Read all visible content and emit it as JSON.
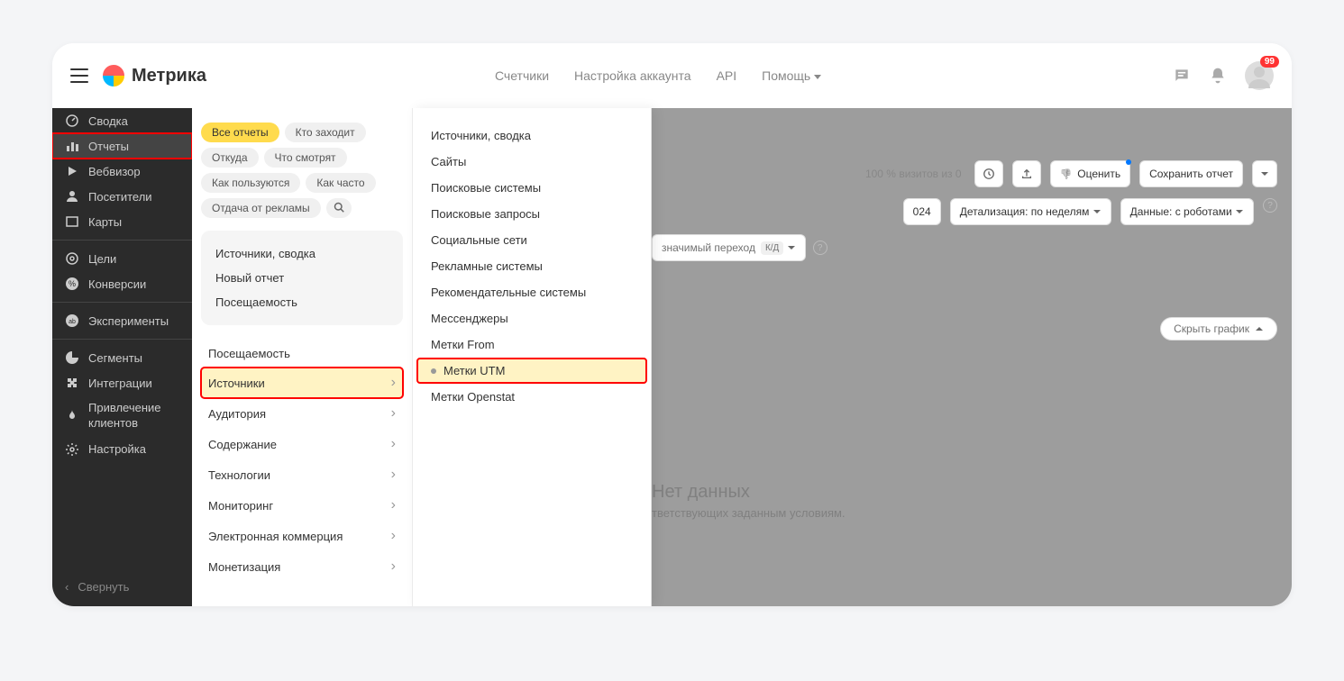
{
  "header": {
    "logo_text": "Метрика",
    "nav": [
      "Счетчики",
      "Настройка аккаунта",
      "API",
      "Помощь"
    ],
    "badge": "99"
  },
  "sidebar": {
    "items": [
      {
        "label": "Сводка",
        "icon": "gauge"
      },
      {
        "label": "Отчеты",
        "icon": "bar-chart",
        "active": true
      },
      {
        "label": "Вебвизор",
        "icon": "play"
      },
      {
        "label": "Посетители",
        "icon": "user"
      },
      {
        "label": "Карты",
        "icon": "map"
      }
    ],
    "items2": [
      {
        "label": "Цели",
        "icon": "target"
      },
      {
        "label": "Конверсии",
        "icon": "percent"
      }
    ],
    "items3": [
      {
        "label": "Эксперименты",
        "icon": "ab"
      }
    ],
    "items4": [
      {
        "label": "Сегменты",
        "icon": "pie"
      },
      {
        "label": "Интеграции",
        "icon": "puzzle"
      },
      {
        "label": "Привлечение клиентов",
        "icon": "flame"
      },
      {
        "label": "Настройка",
        "icon": "gear"
      }
    ],
    "collapse": "Свернуть"
  },
  "panel1": {
    "chips": [
      "Все отчеты",
      "Кто заходит",
      "Откуда",
      "Что смотрят",
      "Как пользуются",
      "Как часто",
      "Отдача от рекламы"
    ],
    "quick": [
      "Источники, сводка",
      "Новый отчет",
      "Посещаемость"
    ],
    "categories": [
      {
        "label": "Посещаемость",
        "chevron": false
      },
      {
        "label": "Источники",
        "chevron": true,
        "highlighted": true
      },
      {
        "label": "Аудитория",
        "chevron": true
      },
      {
        "label": "Содержание",
        "chevron": true
      },
      {
        "label": "Технологии",
        "chevron": true
      },
      {
        "label": "Мониторинг",
        "chevron": true
      },
      {
        "label": "Электронная коммерция",
        "chevron": true
      },
      {
        "label": "Монетизация",
        "chevron": true
      }
    ]
  },
  "panel2": {
    "items": [
      {
        "label": "Источники, сводка"
      },
      {
        "label": "Сайты"
      },
      {
        "label": "Поисковые системы"
      },
      {
        "label": "Поисковые запросы"
      },
      {
        "label": "Социальные сети"
      },
      {
        "label": "Рекламные системы"
      },
      {
        "label": "Рекомендательные системы"
      },
      {
        "label": "Мессенджеры"
      },
      {
        "label": "Метки From"
      },
      {
        "label": "Метки UTM",
        "highlighted": true,
        "dot": true
      },
      {
        "label": "Метки Openstat"
      }
    ]
  },
  "main": {
    "visits_text": "100 % визитов из 0",
    "evaluate": "Оценить",
    "save_report": "Сохранить отчет",
    "date_partial": "024",
    "detail": "Детализация: по неделям",
    "data_mode": "Данные: с роботами",
    "crossing_partial": "значимый переход",
    "kd": "К/Д",
    "hide_chart": "Скрыть график",
    "no_data_title": "Нет данных",
    "no_data_sub": "тветствующих заданным условиям."
  }
}
